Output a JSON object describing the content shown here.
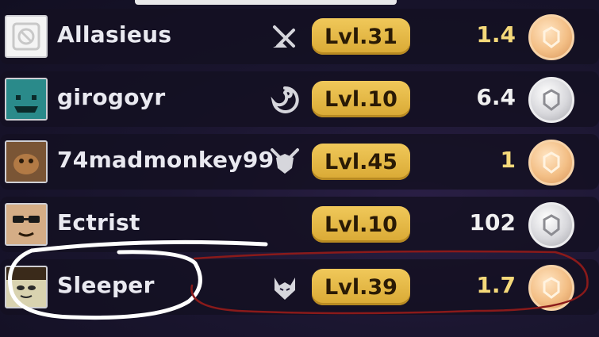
{
  "rows": [
    {
      "name": "Allasieus",
      "level": "Lvl.31",
      "score": "1.4",
      "score_color": "#f5d97a",
      "coin": "bronze",
      "avatar": "blank",
      "role_icon": "crossed-swords-icon"
    },
    {
      "name": "girogoyr",
      "level": "Lvl.10",
      "score": "6.4",
      "score_color": "#f0f0f0",
      "coin": "silver",
      "avatar": "teal",
      "role_icon": "swirl-icon"
    },
    {
      "name": "74madmonkey99",
      "level": "Lvl.45",
      "score": "1",
      "score_color": "#f5d97a",
      "coin": "bronze",
      "avatar": "brown",
      "role_icon": "shield-swords-icon"
    },
    {
      "name": "Ectrist",
      "level": "Lvl.10",
      "score": "102",
      "score_color": "#f0f0f0",
      "coin": "silver",
      "avatar": "glasses",
      "role_icon": ""
    },
    {
      "name": "Sleeper",
      "level": "Lvl.39",
      "score": "1.7",
      "score_color": "#f5d97a",
      "coin": "bronze",
      "avatar": "sleeper",
      "role_icon": "horned-mask-icon"
    }
  ],
  "colors": {
    "level_badge": "#e4b848",
    "score_gold": "#f5d97a",
    "score_white": "#f0f0f0",
    "annotation_white": "#ffffff",
    "annotation_red": "#8a1a1a"
  }
}
